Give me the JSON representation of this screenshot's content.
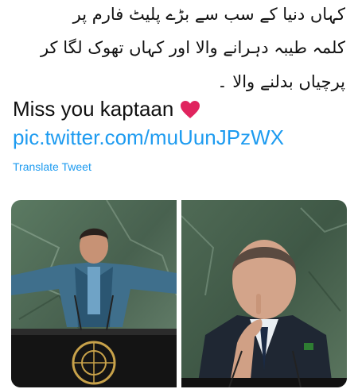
{
  "tweet": {
    "urdu_lines": [
      "کہاں دنیا کے سب سے بڑے پلیٹ فارم پر",
      "کلمہ طیبہ دہرانے والا اور کہاں تھوک لگا کر",
      "پرچیاں بدلنے والا ۔"
    ],
    "miss_text": "Miss you kaptaan",
    "heart_icon": "red-heart-icon",
    "link": "pic.twitter.com/muUunJPzWX",
    "translate_label": "Translate Tweet"
  },
  "colors": {
    "link": "#1d9bf0",
    "heart": "#e0245e",
    "marble": "#4e6b55"
  }
}
